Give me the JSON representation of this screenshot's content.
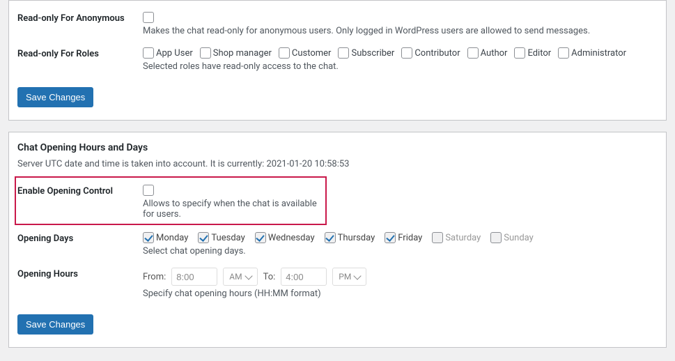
{
  "top": {
    "readonly_anon_label": "Read-only For Anonymous",
    "readonly_anon_desc": "Makes the chat read-only for anonymous users. Only logged in WordPress users are allowed to send messages.",
    "readonly_roles_label": "Read-only For Roles",
    "readonly_roles_desc": "Selected roles have read-only access to the chat.",
    "roles": [
      {
        "label": "App User"
      },
      {
        "label": "Shop manager"
      },
      {
        "label": "Customer"
      },
      {
        "label": "Subscriber"
      },
      {
        "label": "Contributor"
      },
      {
        "label": "Author"
      },
      {
        "label": "Editor"
      },
      {
        "label": "Administrator"
      }
    ],
    "save_label": "Save Changes"
  },
  "hours": {
    "section_title": "Chat Opening Hours and Days",
    "server_note": "Server UTC date and time is taken into account. It is currently: 2021-01-20 10:58:53",
    "enable_label": "Enable Opening Control",
    "enable_desc": "Allows to specify when the chat is available for users.",
    "days_label": "Opening Days",
    "days_desc": "Select chat opening days.",
    "days": [
      {
        "label": "Monday",
        "checked": true
      },
      {
        "label": "Tuesday",
        "checked": true
      },
      {
        "label": "Wednesday",
        "checked": true
      },
      {
        "label": "Thursday",
        "checked": true
      },
      {
        "label": "Friday",
        "checked": true
      },
      {
        "label": "Saturday",
        "checked": false
      },
      {
        "label": "Sunday",
        "checked": false
      }
    ],
    "hours_label": "Opening Hours",
    "from_label": "From:",
    "from_value": "8:00",
    "from_ampm": "AM",
    "to_label": "To:",
    "to_value": "4:00",
    "to_ampm": "PM",
    "hours_desc": "Specify chat opening hours (HH:MM format)",
    "save_label": "Save Changes"
  }
}
